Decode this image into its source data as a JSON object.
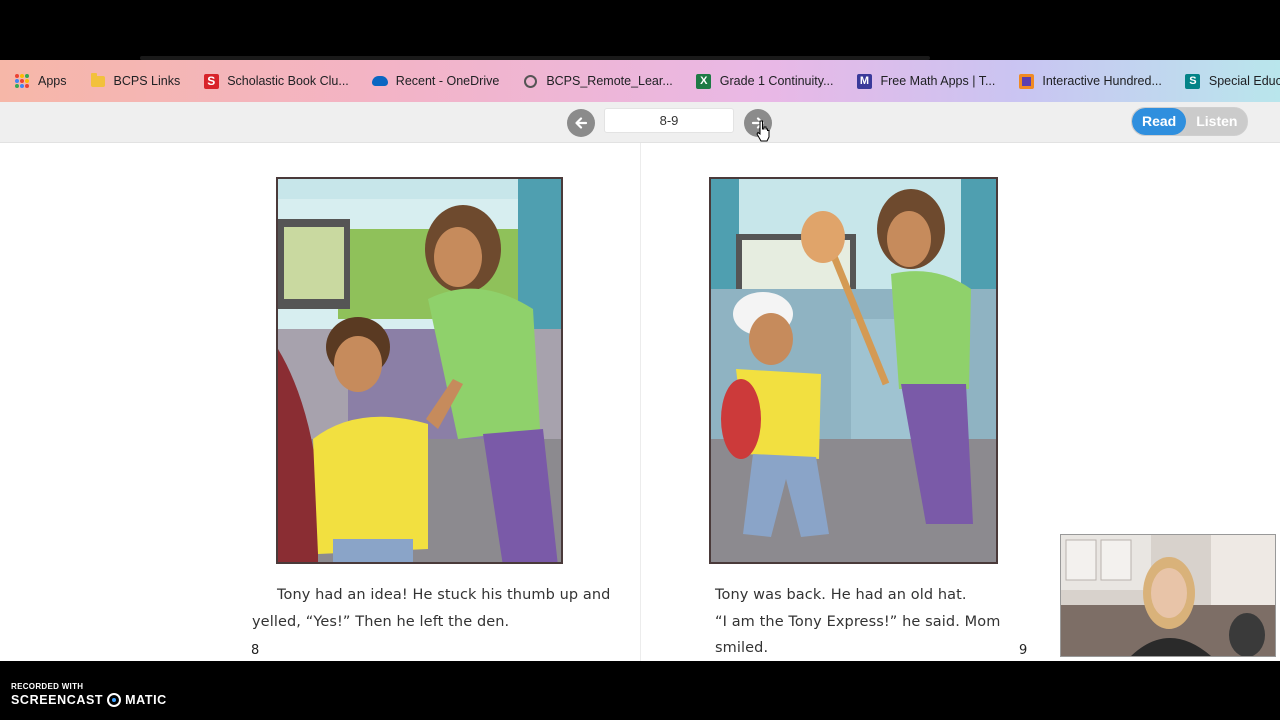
{
  "bookmarks": [
    {
      "label": "Apps",
      "icon": "apps-grid-icon"
    },
    {
      "label": "BCPS Links",
      "icon": "folder-icon"
    },
    {
      "label": "Scholastic Book Clu...",
      "icon": "scholastic-icon"
    },
    {
      "label": "Recent - OneDrive",
      "icon": "onedrive-icon"
    },
    {
      "label": "BCPS_Remote_Lear...",
      "icon": "globe-icon"
    },
    {
      "label": "Grade 1 Continuity...",
      "icon": "excel-icon"
    },
    {
      "label": "Free Math Apps | T...",
      "icon": "math-apps-icon"
    },
    {
      "label": "Interactive Hundred...",
      "icon": "hundred-chart-icon"
    },
    {
      "label": "Special Education S...",
      "icon": "sharepoint-icon"
    }
  ],
  "reader": {
    "page_range": "8-9",
    "modes": {
      "read": "Read",
      "listen": "Listen"
    },
    "active_mode": "Read"
  },
  "pages": {
    "left": {
      "text_line1": "Tony had an idea! He stuck his thumb up and",
      "text_line2": "yelled, “Yes!” Then he left the den.",
      "number": "8"
    },
    "right": {
      "text_line1": "Tony was back. He had an old hat.",
      "text_line2": "“I am the Tony Express!” he said. Mom smiled.",
      "number": "9"
    }
  },
  "watermark": {
    "small": "RECORDED WITH",
    "left": "SCREENCAST",
    "right": "MATIC"
  },
  "colors": {
    "accent": "#2f8fde",
    "nav_button": "#8b8b8b"
  }
}
